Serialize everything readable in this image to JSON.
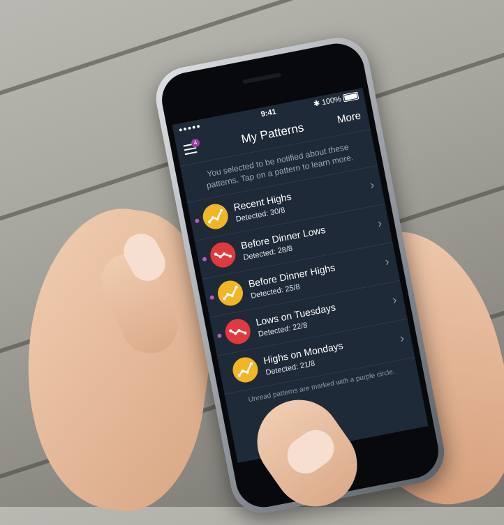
{
  "status_bar": {
    "signal": "●●●●●",
    "time": "9:41",
    "bluetooth": "✱",
    "battery_text": "100%"
  },
  "nav": {
    "title": "My Patterns",
    "more_label": "More",
    "menu_badge": "4"
  },
  "intro_text": "You selected to be notified about these patterns. Tap on a pattern to learn more.",
  "patterns": [
    {
      "title": "Recent Highs",
      "detected": "Detected: 30/8",
      "type": "high",
      "unread": true
    },
    {
      "title": "Before Dinner Lows",
      "detected": "Detected: 28/8",
      "type": "low",
      "unread": true
    },
    {
      "title": "Before Dinner Highs",
      "detected": "Detected: 25/8",
      "type": "high",
      "unread": true
    },
    {
      "title": "Lows on Tuesdays",
      "detected": "Detected: 22/8",
      "type": "low",
      "unread": true
    },
    {
      "title": "Highs on Mondays",
      "detected": "Detected: 21/8",
      "type": "high",
      "unread": false
    }
  ],
  "footnote": "Unread patterns are marked with a purple circle.",
  "colors": {
    "high": "#f2b526",
    "low": "#e0393e",
    "unread": "#b35bbf",
    "screen_bg": "#1e2a37"
  }
}
